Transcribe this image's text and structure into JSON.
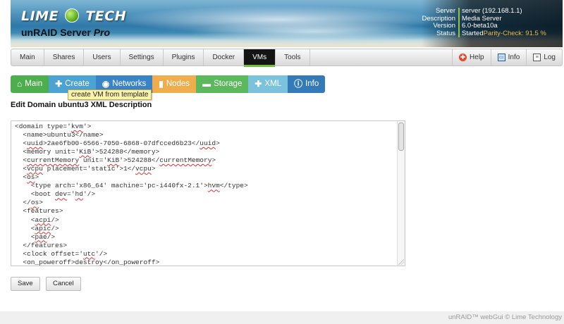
{
  "header": {
    "logo_left": "LIME",
    "logo_right": "TECH",
    "subtitle_main": "unRAID Server",
    "subtitle_edition": "Pro",
    "server_info": [
      {
        "key": "Server",
        "value": "server (192.168.1.1)"
      },
      {
        "key": "Description",
        "value": "Media Server"
      },
      {
        "key": "Version",
        "value": "6.0-beta10a"
      },
      {
        "key": "Status",
        "value": "Started",
        "extra": "Parity-Check: 91.5 %"
      }
    ]
  },
  "nav": {
    "tabs": [
      "Main",
      "Shares",
      "Users",
      "Settings",
      "Plugins",
      "Docker",
      "VMs",
      "Tools"
    ],
    "active": "VMs",
    "right": {
      "help": "Help",
      "info": "Info",
      "log": "Log"
    }
  },
  "toolbar": {
    "buttons": [
      {
        "label": "Main",
        "icon": "home-icon",
        "color": "#4cae4c"
      },
      {
        "label": "Create",
        "icon": "plus-icon",
        "color": "#4ba3d3"
      },
      {
        "label": "Networks",
        "icon": "globe-icon",
        "color": "#3a83c6"
      },
      {
        "label": "Nodes",
        "icon": "bar-chart-icon",
        "color": "#f0ad4e"
      },
      {
        "label": "Storage",
        "icon": "hdd-icon",
        "color": "#5cb85c"
      },
      {
        "label": "XML",
        "icon": "plus-icon",
        "color": "#7bc2dc"
      },
      {
        "label": "Info",
        "icon": "info-icon",
        "color": "#337ab7"
      }
    ]
  },
  "tooltip": "create VM from template",
  "page_title": "Edit Domain ubuntu3 XML Description",
  "editor": {
    "lines": [
      [
        {
          "t": "<domain type='"
        },
        {
          "t": "kvm",
          "sq": true
        },
        {
          "t": "'>"
        }
      ],
      [
        {
          "t": "  <name>ubuntu3</name>"
        }
      ],
      [
        {
          "t": "  <"
        },
        {
          "t": "uuid",
          "sq": true
        },
        {
          "t": ">2ae6fb00-6566-7050-6868-07dfcced6b23</"
        },
        {
          "t": "uuid",
          "sq": true
        },
        {
          "t": ">"
        }
      ],
      [
        {
          "t": "  <memory unit='"
        },
        {
          "t": "KiB",
          "sq": true
        },
        {
          "t": "'>524288</memory>"
        }
      ],
      [
        {
          "t": "  <"
        },
        {
          "t": "currentMemory",
          "sq": true
        },
        {
          "t": " unit='"
        },
        {
          "t": "KiB",
          "sq": true
        },
        {
          "t": "'>524288</"
        },
        {
          "t": "currentMemory",
          "sq": true
        },
        {
          "t": ">"
        }
      ],
      [
        {
          "t": "  <"
        },
        {
          "t": "vcpu",
          "sq": true
        },
        {
          "t": " placement='static'>1</"
        },
        {
          "t": "vcpu",
          "sq": true
        },
        {
          "t": ">"
        }
      ],
      [
        {
          "t": "  <"
        },
        {
          "t": "os",
          "sq": true
        },
        {
          "t": ">"
        }
      ],
      [
        {
          "t": "    <type arch='x86_64' machine='pc-i440fx-2.1'>"
        },
        {
          "t": "hvm",
          "sq": true
        },
        {
          "t": "</type>"
        }
      ],
      [
        {
          "t": "    <boot "
        },
        {
          "t": "dev",
          "sq": true
        },
        {
          "t": "='"
        },
        {
          "t": "hd",
          "sq": true
        },
        {
          "t": "'/>"
        }
      ],
      [
        {
          "t": "  </"
        },
        {
          "t": "os",
          "sq": true
        },
        {
          "t": ">"
        }
      ],
      [
        {
          "t": "  <features>"
        }
      ],
      [
        {
          "t": "    <"
        },
        {
          "t": "acpi",
          "sq": true
        },
        {
          "t": "/>"
        }
      ],
      [
        {
          "t": "    <"
        },
        {
          "t": "apic",
          "sq": true
        },
        {
          "t": "/>"
        }
      ],
      [
        {
          "t": "    <"
        },
        {
          "t": "pae",
          "sq": true
        },
        {
          "t": "/>"
        }
      ],
      [
        {
          "t": "  </features>"
        }
      ],
      [
        {
          "t": "  <clock offset='"
        },
        {
          "t": "utc",
          "sq": true
        },
        {
          "t": "'/>"
        }
      ],
      [
        {
          "t": "  <"
        },
        {
          "t": "on_poweroff",
          "sq": true
        },
        {
          "t": ">destroy</"
        },
        {
          "t": "on_poweroff",
          "sq": true
        },
        {
          "t": ">"
        }
      ]
    ]
  },
  "buttons": {
    "save": "Save",
    "cancel": "Cancel"
  },
  "footer": "unRAID™ webGui © Lime Technology"
}
